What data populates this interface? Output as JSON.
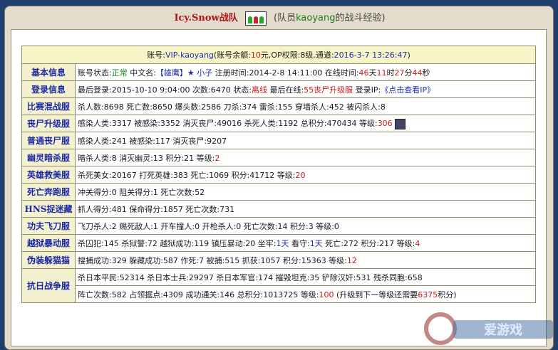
{
  "title": {
    "team": "Icy.Snow",
    "team_suffix": "战队",
    "member_prefix": "(队员",
    "member_name": "kaoyang",
    "member_suffix": "的战斗经验)"
  },
  "account": {
    "label_account": "账号:",
    "account_name": "VIP-kaoyang",
    "label_balance": "(账号余额:",
    "balance": "10",
    "unit_yuan": "元,",
    "label_op": "OP权限:",
    "op_level": "8级,",
    "label_channel": "通道:",
    "channel_time": "2016-3-7 13:26:47",
    "close": ")"
  },
  "rows": {
    "basic": {
      "label": "基本信息",
      "t1": "账号状态:",
      "status": "正常",
      "t2": " 中文名:",
      "cn_name": "【雄鹰】★ 小子",
      "t3": " 注册时间:",
      "reg_time": "2014-2-8 14:11:00",
      "t4": " 在线时间:",
      "d": "46",
      "t5": "天",
      "h": "11",
      "t6": "时",
      "m": "27",
      "t7": "分",
      "s": "44",
      "t8": "秒"
    },
    "login": {
      "label": "登录信息",
      "t1": "最后登录:",
      "last_login": "2015-10-10 9:04:00",
      "t2": " 次数:",
      "count": "6470",
      "t3": " 状态:",
      "status": "离线",
      "t4": " 最后在线:",
      "last_online": "55丧尸升级服",
      "t5": " 登录IP:",
      "ip": "《点击查看IP》"
    },
    "mixed": {
      "label": "比赛混战服",
      "text": "杀人数:8698 死亡数:8650 爆头数:2586 刀杀:374 雷杀:155 穿墙杀人:452 被闪杀人:8"
    },
    "zombie_up": {
      "label": "丧尸升级服",
      "t1": "感染人类:3317 被感染:3352 消灭丧尸:49016 杀死人类:1192 总积分:470434 等级:",
      "level": "306"
    },
    "zombie": {
      "label": "普通丧尸服",
      "text": "感染人类:241 被感染:117 消灭丧尸:9207"
    },
    "ghost": {
      "label": "幽灵暗杀服",
      "t1": "暗杀人类:8 消灭幽灵:13 积分:21 等级:",
      "level": "2"
    },
    "hero": {
      "label": "英雄救美服",
      "t1": "杀死美女:20167 打死英雄:383 死亡:1069 积分:41712 等级:",
      "level": "20"
    },
    "run": {
      "label": "死亡奔跑服",
      "text": "冲关得分:0 阻关得分:1 死亡次数:52"
    },
    "hns": {
      "label": "HNS捉迷藏",
      "text": "抓人得分:481 保命得分:1857 死亡次数:731"
    },
    "kungfu": {
      "label": "功夫飞刀服",
      "text": "飞刀杀人:2 赐死敌人:1 开车撞人:0 开枪杀人:0 死亡次数:14 积分:3 等级:0"
    },
    "jail": {
      "label": "越狱暴动服",
      "t1": "杀囚犯:145 杀狱警:72 越狱成功:119 镇压暴动:20 坐牢:",
      "jail_days": "1天",
      "t2": " 看守:",
      "guard_days": "1天",
      "t3": " 死亡:272 积分:217 等级:",
      "level": "4"
    },
    "hide": {
      "label": "伪装躲猫猫",
      "t1": "搜捕成功:329 躲藏成功:587 作死:7 被捕:515 抓获:1057 积分:15363 等级:",
      "level": "12"
    },
    "war": {
      "label": "抗日战争服",
      "line1": "杀日本平民:52314 杀日本士兵:29297 杀日本军官:174 摧毁坦克:35 铲除汉奸:531 残杀同胞:658",
      "t1": "阵亡次数:582 占领据点:4309 成功通关:146 总积分:1013725 等级:",
      "level": "100",
      "t2": " (升级到下一等级还需要",
      "need": "6375",
      "t3": "积分)"
    }
  },
  "watermark": {
    "text": "爱游戏"
  }
}
